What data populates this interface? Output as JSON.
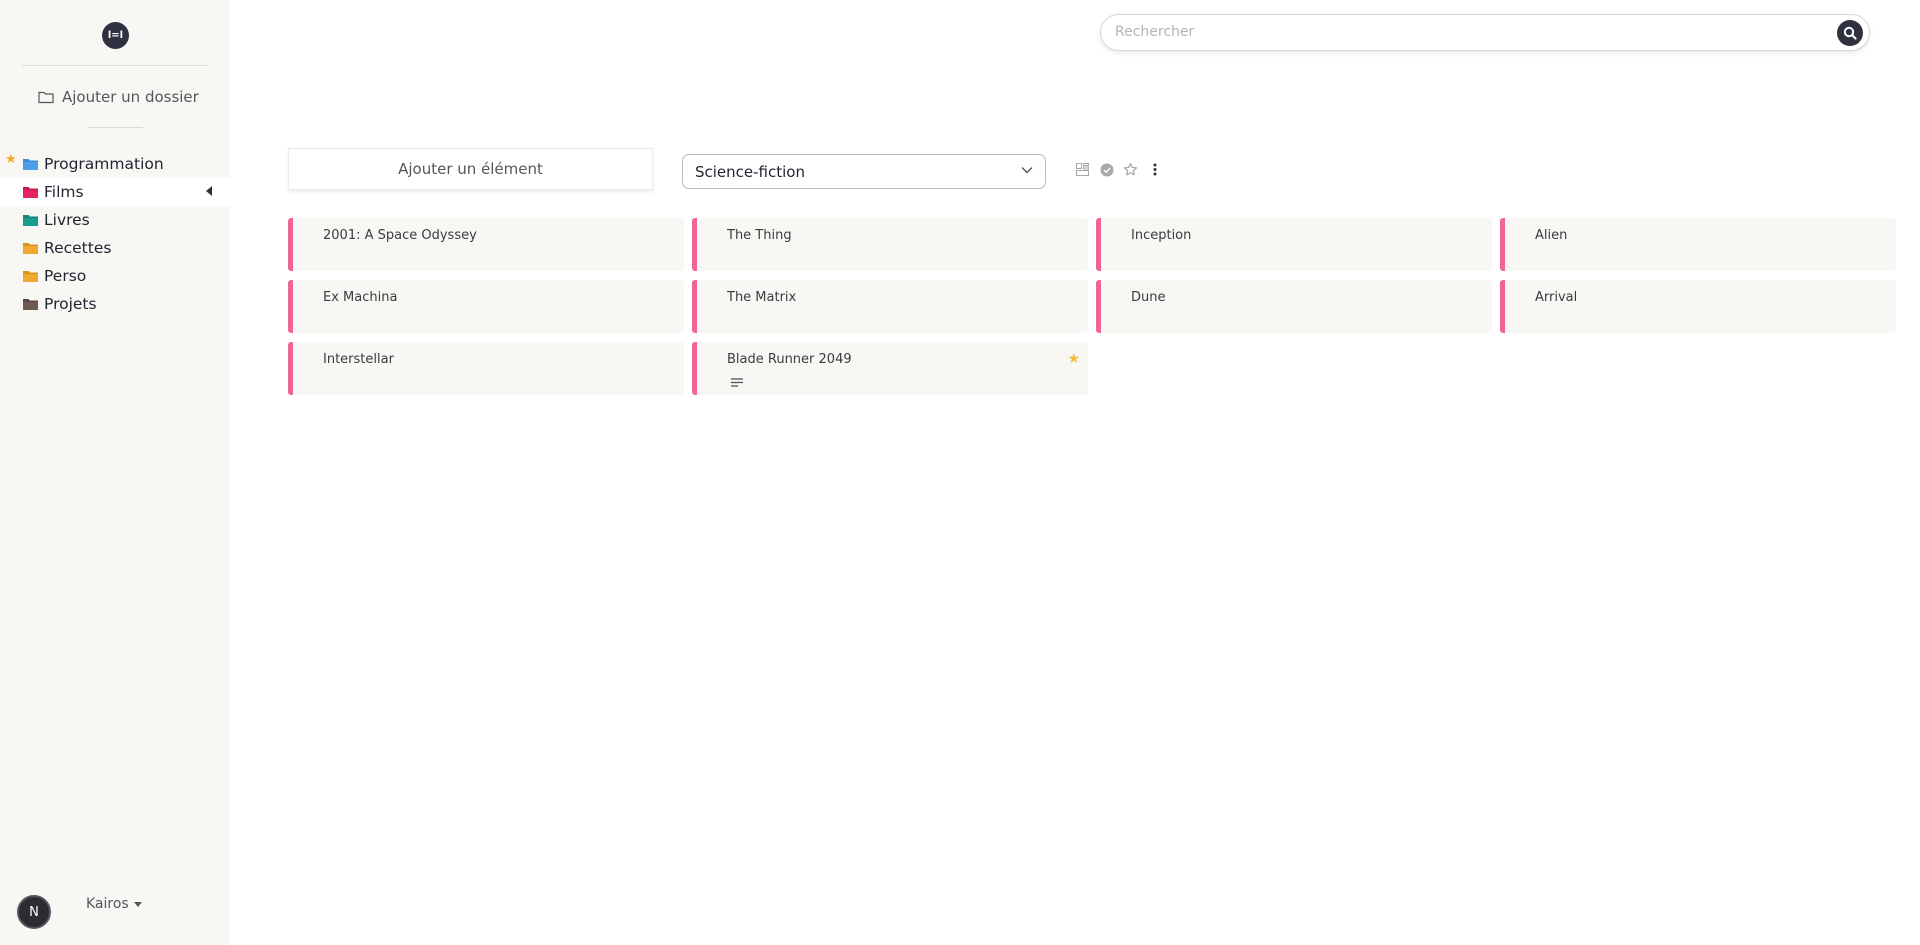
{
  "app": {
    "logo_text": "l=l"
  },
  "sidebar": {
    "add_folder_label": "Ajouter un dossier",
    "folders": [
      {
        "label": "Programmation",
        "color": "#3b8fd9",
        "starred": true
      },
      {
        "label": "Films",
        "color": "#e4235f",
        "active": true
      },
      {
        "label": "Livres",
        "color": "#1a9c8c"
      },
      {
        "label": "Recettes",
        "color": "#f0a92e"
      },
      {
        "label": "Perso",
        "color": "#f0a92e"
      },
      {
        "label": "Projets",
        "color": "#6e5a52"
      }
    ],
    "user": {
      "avatar_letter": "N",
      "name": "Kairos"
    }
  },
  "search": {
    "placeholder": "Rechercher"
  },
  "toolbar": {
    "add_item_label": "Ajouter un élément",
    "category_select": {
      "selected": "Science-fiction"
    }
  },
  "cards": [
    {
      "title": "2001: A Space Odyssey"
    },
    {
      "title": "The Thing"
    },
    {
      "title": "Inception"
    },
    {
      "title": "Alien"
    },
    {
      "title": "Ex Machina"
    },
    {
      "title": "The Matrix"
    },
    {
      "title": "Dune"
    },
    {
      "title": "Arrival"
    },
    {
      "title": "Interstellar"
    },
    {
      "title": "Blade Runner 2049",
      "starred": true,
      "has_note": true
    }
  ],
  "colors": {
    "accent": "#f06595",
    "dark": "#2f3140",
    "sidebar_bg": "#f8f7f4",
    "star": "#f0bf3a"
  }
}
